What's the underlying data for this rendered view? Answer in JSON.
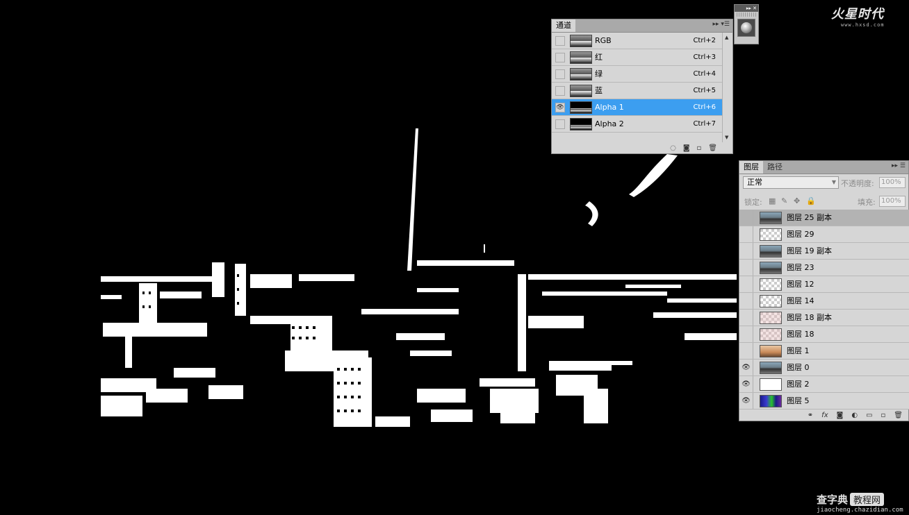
{
  "watermark_top": {
    "logo": "火星时代",
    "url": "www.hxsd.com"
  },
  "watermark_bottom": {
    "brand": "查字典",
    "tag": "教程网",
    "url": "jiaocheng.chazidian.com"
  },
  "mini_palette": {
    "buttons": "▸▸ ✕"
  },
  "channels_panel": {
    "tab": "通道",
    "menu": "▸▸ ▾☰",
    "rows": [
      {
        "name": "RGB",
        "shortcut": "Ctrl+2",
        "visible": false,
        "selected": false
      },
      {
        "name": "红",
        "shortcut": "Ctrl+3",
        "visible": false,
        "selected": false
      },
      {
        "name": "绿",
        "shortcut": "Ctrl+4",
        "visible": false,
        "selected": false
      },
      {
        "name": "蓝",
        "shortcut": "Ctrl+5",
        "visible": false,
        "selected": false
      },
      {
        "name": "Alpha 1",
        "shortcut": "Ctrl+6",
        "visible": true,
        "selected": true
      },
      {
        "name": "Alpha 2",
        "shortcut": "Ctrl+7",
        "visible": false,
        "selected": false
      }
    ],
    "footer_icons": [
      "load-selection-icon",
      "save-selection-icon",
      "new-channel-icon",
      "trash-icon"
    ]
  },
  "layers_panel": {
    "tabs": [
      "图层",
      "路径"
    ],
    "menu": "▸▸ ☰",
    "blend_mode": "正常",
    "opacity_label": "不透明度:",
    "opacity_value": "100%",
    "lock_label": "锁定:",
    "fill_label": "填充:",
    "fill_value": "100%",
    "layers": [
      {
        "name": "图层 25 副本",
        "visible": false,
        "selected": true,
        "thumb": "city"
      },
      {
        "name": "图层 29",
        "visible": false,
        "selected": false,
        "thumb": "trans"
      },
      {
        "name": "图层 19 副本",
        "visible": false,
        "selected": false,
        "thumb": "city"
      },
      {
        "name": "图层 23",
        "visible": false,
        "selected": false,
        "thumb": "city"
      },
      {
        "name": "图层 12",
        "visible": false,
        "selected": false,
        "thumb": "trans"
      },
      {
        "name": "图层 14",
        "visible": false,
        "selected": false,
        "thumb": "trans"
      },
      {
        "name": "图层 18 副本",
        "visible": false,
        "selected": false,
        "thumb": "transpink"
      },
      {
        "name": "图层 18",
        "visible": false,
        "selected": false,
        "thumb": "transpink"
      },
      {
        "name": "图层 1",
        "visible": false,
        "selected": false,
        "thumb": "warm"
      },
      {
        "name": "图层 0",
        "visible": true,
        "selected": false,
        "thumb": "city"
      },
      {
        "name": "图层 2",
        "visible": true,
        "selected": false,
        "thumb": "white"
      },
      {
        "name": "图层 5",
        "visible": true,
        "selected": false,
        "thumb": "color"
      }
    ],
    "footer_icons": [
      "link-icon",
      "fx-icon",
      "mask-icon",
      "adjustment-icon",
      "group-folder-icon",
      "new-layer-icon",
      "trash-icon"
    ]
  }
}
